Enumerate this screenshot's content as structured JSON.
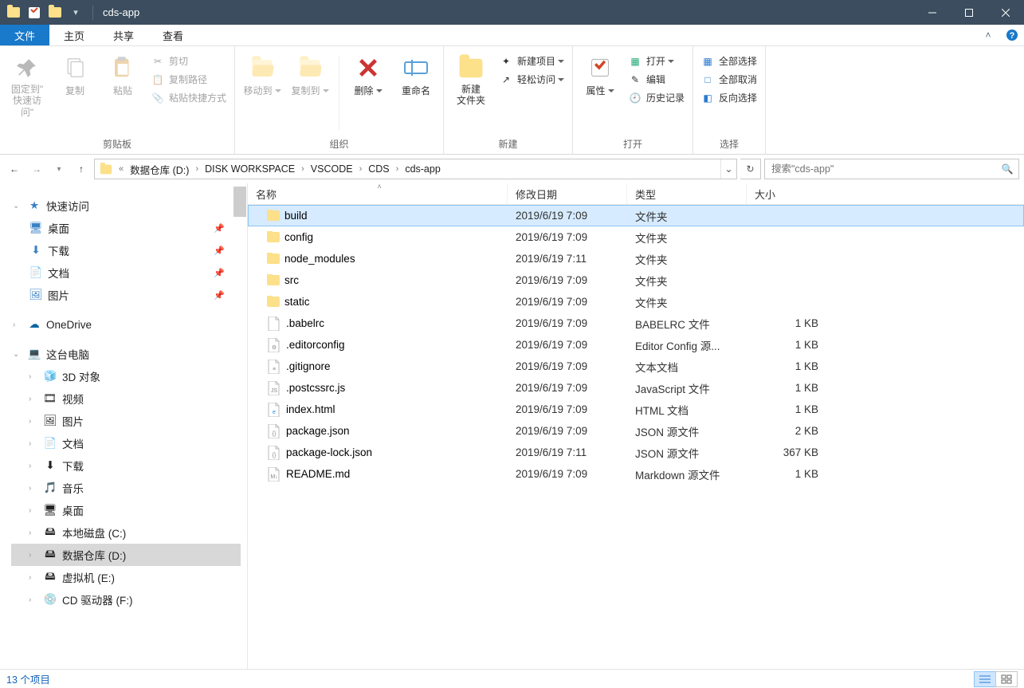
{
  "window": {
    "title": "cds-app"
  },
  "tabs": {
    "file": "文件",
    "home": "主页",
    "share": "共享",
    "view": "查看"
  },
  "ribbon": {
    "clipboard": {
      "label": "剪贴板",
      "pin": "固定到\"\n快速访问\"",
      "copy": "复制",
      "paste": "粘贴",
      "cut": "剪切",
      "copypath": "复制路径",
      "pasteshortcut": "粘贴快捷方式"
    },
    "organize": {
      "label": "组织",
      "moveto": "移动到",
      "copyto": "复制到",
      "delete": "删除",
      "rename": "重命名"
    },
    "new": {
      "label": "新建",
      "newfolder": "新建\n文件夹",
      "newitem": "新建项目",
      "easyaccess": "轻松访问"
    },
    "open": {
      "label": "打开",
      "properties": "属性",
      "open": "打开",
      "edit": "编辑",
      "history": "历史记录"
    },
    "select": {
      "label": "选择",
      "all": "全部选择",
      "none": "全部取消",
      "invert": "反向选择"
    }
  },
  "breadcrumb": [
    "数据仓库 (D:)",
    "DISK WORKSPACE",
    "VSCODE",
    "CDS",
    "cds-app"
  ],
  "search_placeholder": "搜索\"cds-app\"",
  "columns": {
    "name": "名称",
    "date": "修改日期",
    "type": "类型",
    "size": "大小"
  },
  "rows": [
    {
      "icon": "folder",
      "name": "build",
      "date": "2019/6/19 7:09",
      "type": "文件夹",
      "size": "",
      "selected": true
    },
    {
      "icon": "folder",
      "name": "config",
      "date": "2019/6/19 7:09",
      "type": "文件夹",
      "size": ""
    },
    {
      "icon": "folder",
      "name": "node_modules",
      "date": "2019/6/19 7:11",
      "type": "文件夹",
      "size": ""
    },
    {
      "icon": "folder",
      "name": "src",
      "date": "2019/6/19 7:09",
      "type": "文件夹",
      "size": ""
    },
    {
      "icon": "folder",
      "name": "static",
      "date": "2019/6/19 7:09",
      "type": "文件夹",
      "size": ""
    },
    {
      "icon": "file",
      "name": ".babelrc",
      "date": "2019/6/19 7:09",
      "type": "BABELRC 文件",
      "size": "1 KB"
    },
    {
      "icon": "cfg",
      "name": ".editorconfig",
      "date": "2019/6/19 7:09",
      "type": "Editor Config 源...",
      "size": "1 KB"
    },
    {
      "icon": "txt",
      "name": ".gitignore",
      "date": "2019/6/19 7:09",
      "type": "文本文档",
      "size": "1 KB"
    },
    {
      "icon": "js",
      "name": ".postcssrc.js",
      "date": "2019/6/19 7:09",
      "type": "JavaScript 文件",
      "size": "1 KB"
    },
    {
      "icon": "html",
      "name": "index.html",
      "date": "2019/6/19 7:09",
      "type": "HTML 文档",
      "size": "1 KB"
    },
    {
      "icon": "json",
      "name": "package.json",
      "date": "2019/6/19 7:09",
      "type": "JSON 源文件",
      "size": "2 KB"
    },
    {
      "icon": "json",
      "name": "package-lock.json",
      "date": "2019/6/19 7:11",
      "type": "JSON 源文件",
      "size": "367 KB"
    },
    {
      "icon": "md",
      "name": "README.md",
      "date": "2019/6/19 7:09",
      "type": "Markdown 源文件",
      "size": "1 KB"
    }
  ],
  "nav": {
    "quick": "快速访问",
    "desktop": "桌面",
    "downloads": "下载",
    "documents": "文档",
    "pictures": "图片",
    "onedrive": "OneDrive",
    "thispc": "这台电脑",
    "objects3d": "3D 对象",
    "videos": "视频",
    "pictures2": "图片",
    "documents2": "文档",
    "downloads2": "下载",
    "music": "音乐",
    "desktop2": "桌面",
    "cdrive": "本地磁盘 (C:)",
    "ddrive": "数据仓库 (D:)",
    "edrive": "虚拟机 (E:)",
    "fdrive": "CD 驱动器 (F:)"
  },
  "status": {
    "count": "13 个项目"
  }
}
